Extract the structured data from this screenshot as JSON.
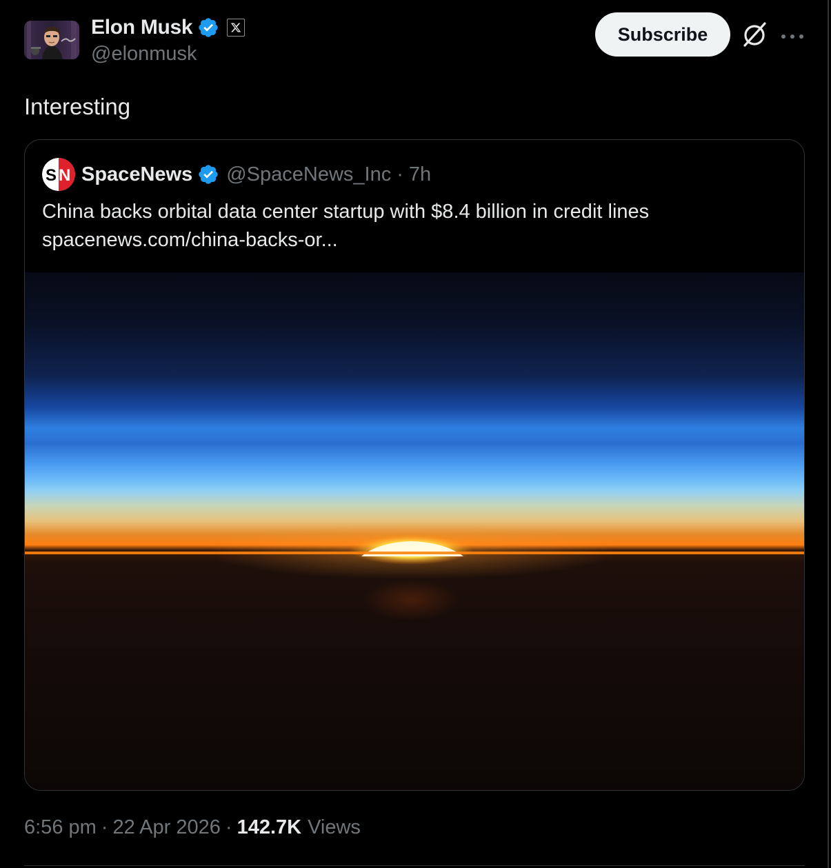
{
  "author": {
    "display_name": "Elon Musk",
    "handle": "@elonmusk",
    "verified": true,
    "affiliate_badge": "X"
  },
  "actions": {
    "subscribe_label": "Subscribe",
    "grok_icon": "grok-icon",
    "more_icon": "more-options-icon"
  },
  "tweet": {
    "text": "Interesting"
  },
  "quote": {
    "display_name": "SpaceNews",
    "handle": "@SpaceNews_Inc",
    "separator": "·",
    "time": "7h",
    "text_line1": "China backs orbital data center startup with $8.4 billion in credit lines",
    "link": "spacenews.com/china-backs-or...",
    "avatar_letters": "SN",
    "image_alt": "Sunrise over Earth's horizon seen from orbit"
  },
  "meta": {
    "time": "6:56 pm",
    "separator": "·",
    "date": "22 Apr 2026",
    "views_count": "142.7K",
    "views_label": "Views"
  },
  "colors": {
    "background": "#000000",
    "text_primary": "#e7e9ea",
    "text_secondary": "#71767b",
    "verified_blue": "#1d9bf0",
    "border": "#2f3336",
    "subscribe_bg": "#eff3f4"
  }
}
